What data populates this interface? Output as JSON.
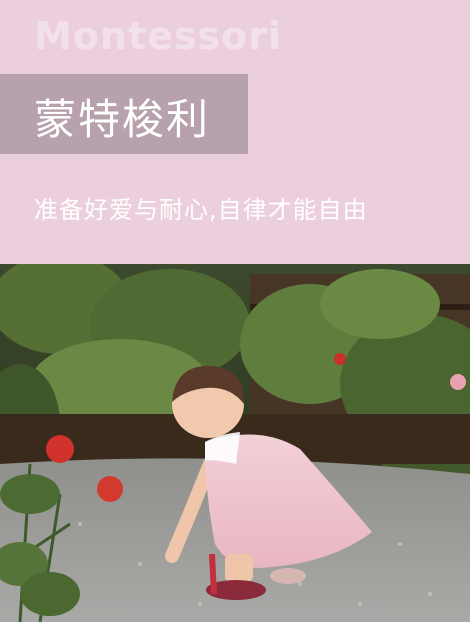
{
  "header": {
    "english_word": "Montessori",
    "title": "蒙特梭利",
    "slogan": "准备好爱与耐心,自律才能自由"
  },
  "photo": {
    "subject": "toddler-in-pink-dress-in-garden-photo"
  },
  "colors": {
    "background_pink": "#eccfdc",
    "title_box": "#b7a1ac",
    "text_white": "#ffffff"
  }
}
